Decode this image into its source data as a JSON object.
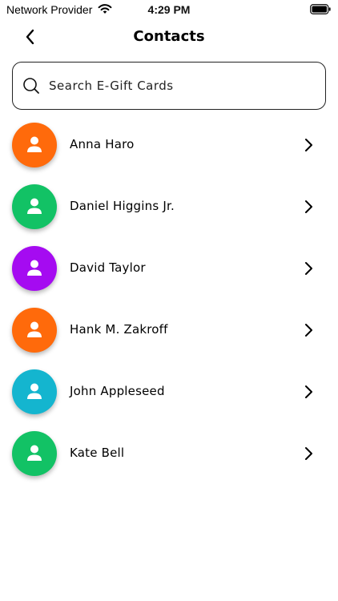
{
  "status_bar": {
    "carrier": "Network Provider",
    "time": "4:29 PM"
  },
  "nav": {
    "title": "Contacts"
  },
  "search": {
    "placeholder": "Search E-Gift Cards",
    "value": ""
  },
  "contacts": [
    {
      "name": "Anna Haro",
      "avatar_color": "#FF6A0B"
    },
    {
      "name": "Daniel Higgins Jr.",
      "avatar_color": "#12C265"
    },
    {
      "name": "David Taylor",
      "avatar_color": "#A50BF1"
    },
    {
      "name": "Hank M. Zakroff",
      "avatar_color": "#FF6A0B"
    },
    {
      "name": "John Appleseed",
      "avatar_color": "#14B5CF"
    },
    {
      "name": "Kate Bell",
      "avatar_color": "#12C265"
    }
  ],
  "icons": {
    "back": "chevron-left-icon",
    "search": "search-icon",
    "avatar": "person-icon",
    "row": "chevron-right-icon"
  }
}
